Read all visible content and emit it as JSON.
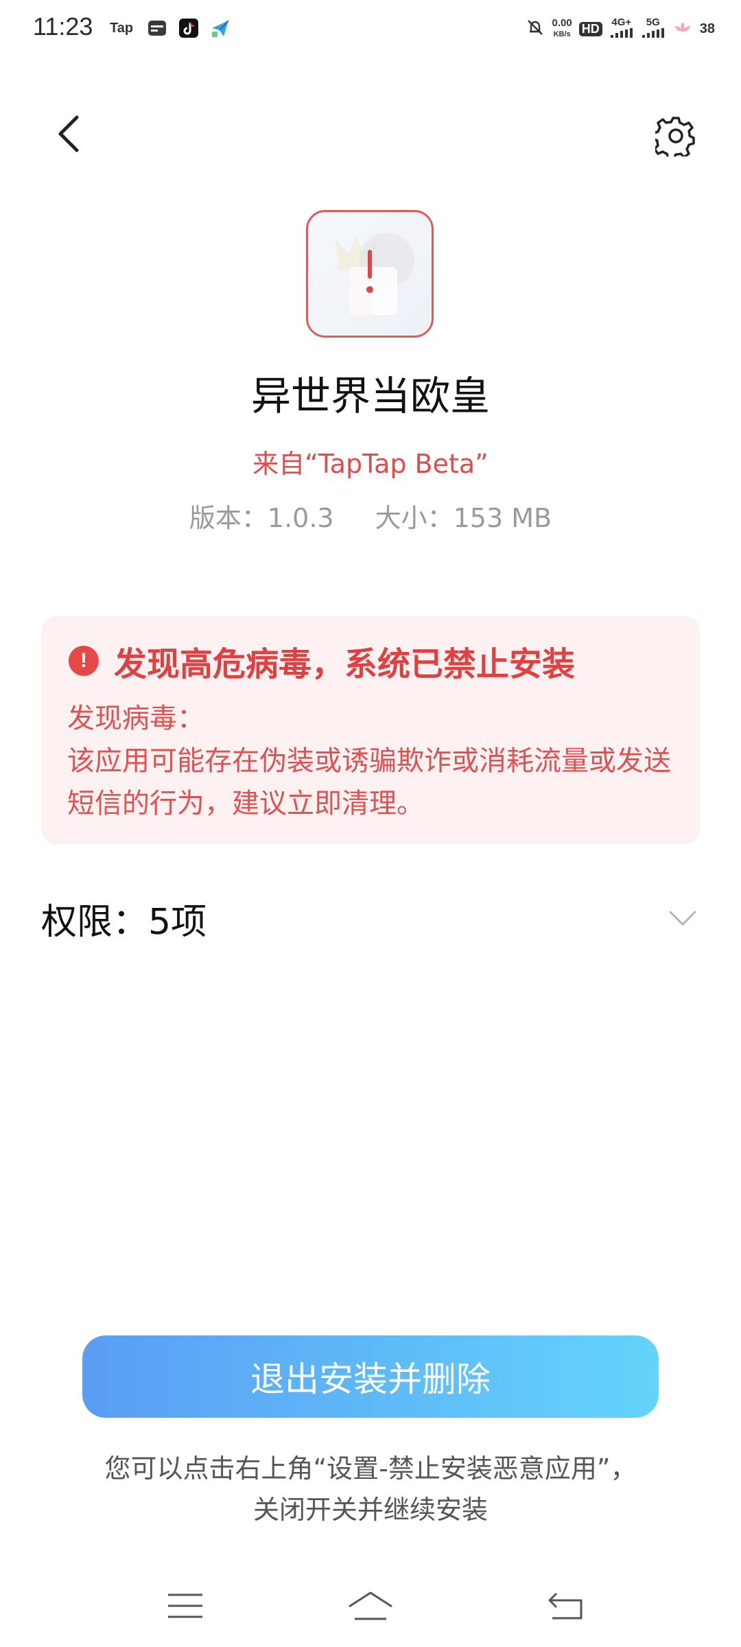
{
  "status_bar": {
    "time": "11:23",
    "notif_apps": [
      "Tap",
      "wallet-icon",
      "tiktok-icon",
      "send-icon"
    ],
    "net_speed_value": "0.00",
    "net_speed_unit": "KB/s",
    "hd": "HD",
    "sim1_type": "4G+",
    "sim2_type": "5G",
    "battery": "38"
  },
  "header": {
    "back_icon": "chevron-left-icon",
    "settings_icon": "gear-icon"
  },
  "app": {
    "name": "异世界当欧皇",
    "source": "来自“TapTap Beta”",
    "version": "版本：1.0.3",
    "size": "大小：153 MB"
  },
  "warning": {
    "title": "发现高危病毒，系统已禁止安装",
    "line1": "发现病毒：",
    "body": "该应用可能存在伪装或诱骗欺诈或消耗流量或发送短信的行为，建议立即清理。",
    "color": "#e04040",
    "background": "#fdf1f1"
  },
  "permissions": {
    "label": "权限：5项"
  },
  "action": {
    "primary_label": "退出安装并删除",
    "hint_line1": "您可以点击右上角“设置-禁止安装恶意应用”，",
    "hint_line2": "关闭开关并继续安装",
    "gradient_start": "#5a9df4",
    "gradient_end": "#63d4fb"
  },
  "navbar": {
    "icons": [
      "menu-icon",
      "home-icon",
      "back-icon"
    ]
  }
}
